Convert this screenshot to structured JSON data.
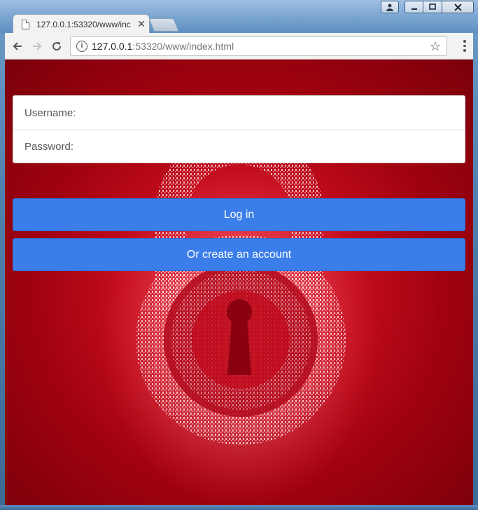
{
  "browser": {
    "tab_title": "127.0.0.1:53320/www/inc",
    "tab_close_glyph": "✕",
    "url_host": "127.0.0.1",
    "url_rest": ":53320/www/index.html",
    "nav_icons": {
      "back": "arrow-left-icon",
      "forward": "arrow-right-icon",
      "reload": "reload-icon",
      "info": "info-icon",
      "bookmark": "star-icon",
      "menu": "kebab-menu-icon"
    },
    "window_controls": [
      "user-icon",
      "minimize-icon",
      "maximize-icon",
      "close-icon"
    ]
  },
  "login_form": {
    "username_label": "Username:",
    "username_value": "",
    "password_label": "Password:",
    "password_value": ""
  },
  "buttons": {
    "login_label": "Log in",
    "create_label": "Or create an account"
  },
  "colors": {
    "button_bg": "#3b7de9",
    "background_red": "#c30c1c"
  }
}
